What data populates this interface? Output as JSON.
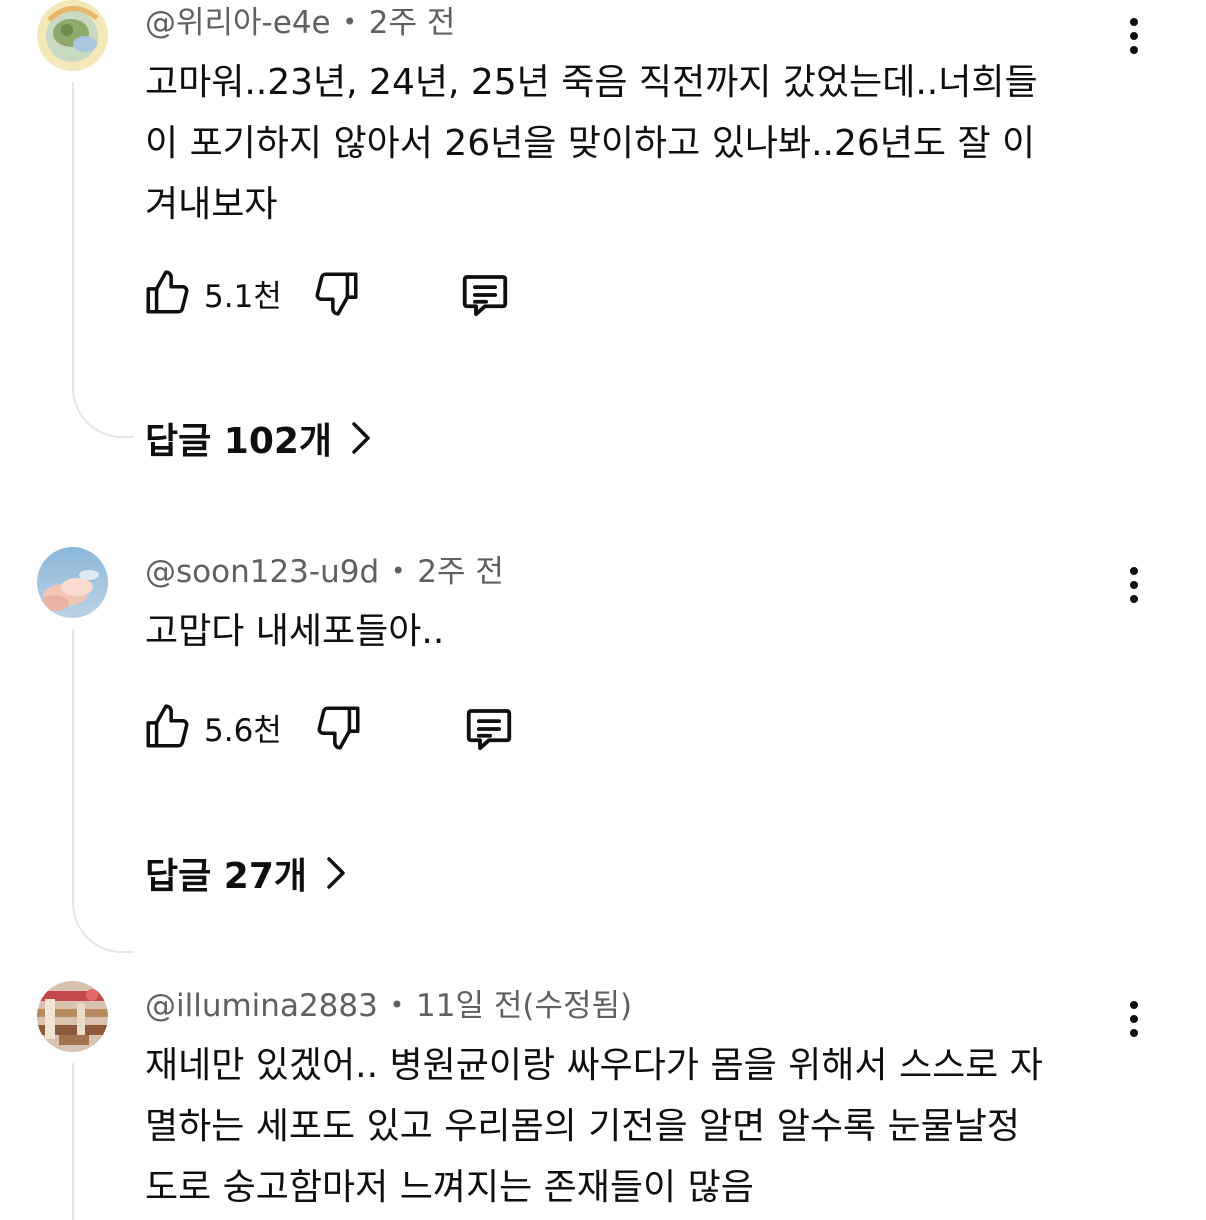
{
  "comments": [
    {
      "author": "@위리아-e4e",
      "time": "2주 전",
      "text": "고마워..23년, 24년, 25년 죽음 직전까지 갔었는데..너희들\n이 포기하지 않아서 26년을 맞이하고 있나봐..26년도 잘 이\n겨내보자",
      "likes": "5.1천",
      "replies": "답글 102개"
    },
    {
      "author": "@soon123-u9d",
      "time": "2주 전",
      "text": "고맙다 내세포들아..",
      "likes": "5.6천",
      "replies": "답글 27개"
    },
    {
      "author": "@illumina2883",
      "time": "11일 전(수정됨)",
      "text": "재네만 있겠어.. 병원균이랑 싸우다가 몸을 위해서 스스로 자\n멸하는 세포도 있고 우리몸의 기전을 알면 알수록 눈물날정\n도로 숭고함마저 느껴지는 존재들이 많음"
    }
  ],
  "icons": {
    "like": "thumbs-up-icon",
    "dislike": "thumbs-down-icon",
    "reply": "comment-icon",
    "more": "more-vertical-icon",
    "chevron": "chevron-right-icon"
  },
  "colors": {
    "text": "#0f0f0f",
    "meta": "#606060",
    "thread_line": "#e6e6e6"
  }
}
